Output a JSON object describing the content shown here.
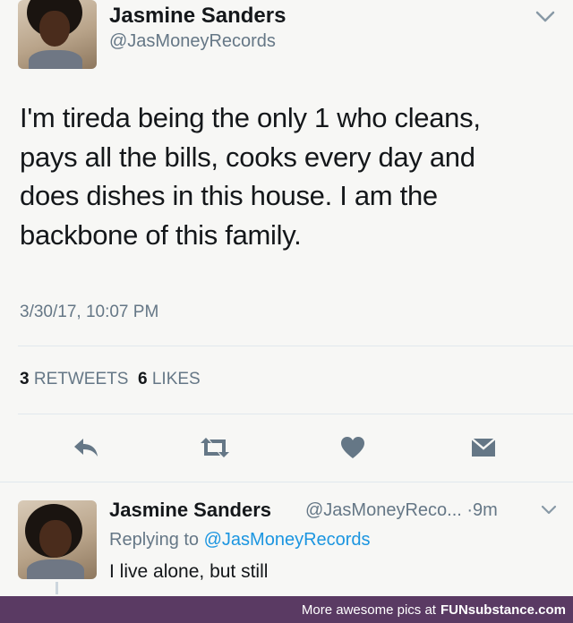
{
  "tweet": {
    "author_name": "Jasmine Sanders",
    "author_handle": "@JasMoneyRecords",
    "text_lines": [
      "I'm tireda being the only 1 who cleans,",
      "pays all the bills, cooks every day and",
      "does dishes in this house. I am the",
      "backbone of this family."
    ],
    "timestamp": "3/30/17, 10:07 PM",
    "retweets_count": "3",
    "retweets_label": "RETWEETS",
    "likes_count": "6",
    "likes_label": "LIKES"
  },
  "actions": [
    "reply-icon",
    "retweet-icon",
    "like-icon",
    "message-icon"
  ],
  "reply": {
    "author_name": "Jasmine Sanders",
    "author_handle": "@JasMoneyReco...",
    "time": "·9m",
    "replying_prefix": "Replying to",
    "replying_handle": "@JasMoneyRecords",
    "text": "I live alone, but still"
  },
  "footer": {
    "text": "More awesome pics at",
    "brand": "FUNsubstance.com"
  },
  "colors": {
    "link": "#1b95e0",
    "muted": "#657786",
    "footer_bg": "#5a3a63"
  }
}
